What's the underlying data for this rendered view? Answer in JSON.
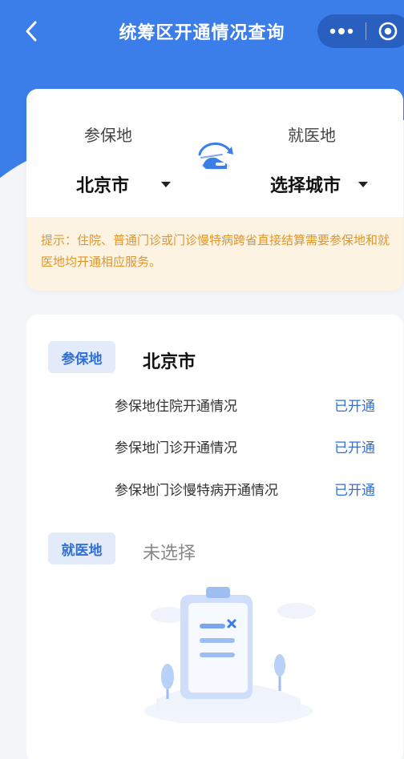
{
  "nav": {
    "title": "统筹区开通情况查询",
    "back_icon": "chevron-left-icon",
    "more_icon": "more-dots-icon",
    "close_icon": "target-circle-icon"
  },
  "colors": {
    "primary": "#3b7de9",
    "tip_text": "#e0962a",
    "tip_bg": "#fdf3e3",
    "tag_bg": "#e3ebfb",
    "status": "#2f6fdc"
  },
  "selector": {
    "insured_label": "参保地",
    "insured_city": "北京市",
    "medical_label": "就医地",
    "medical_city": "选择城市",
    "swap_icon": "swap-location-icon",
    "tip": "提示：住院、普通门诊或门诊慢特病跨省直接结算需要参保地和就医地均开通相应服务。"
  },
  "result": {
    "insured": {
      "tag": "参保地",
      "city": "北京市",
      "rows": [
        {
          "label": "参保地住院开通情况",
          "status": "已开通"
        },
        {
          "label": "参保地门诊开通情况",
          "status": "已开通"
        },
        {
          "label": "参保地门诊慢特病开通情况",
          "status": "已开通"
        }
      ]
    },
    "medical": {
      "tag": "就医地",
      "city": "未选择"
    },
    "empty_illustration_icon": "clipboard-empty-icon"
  }
}
